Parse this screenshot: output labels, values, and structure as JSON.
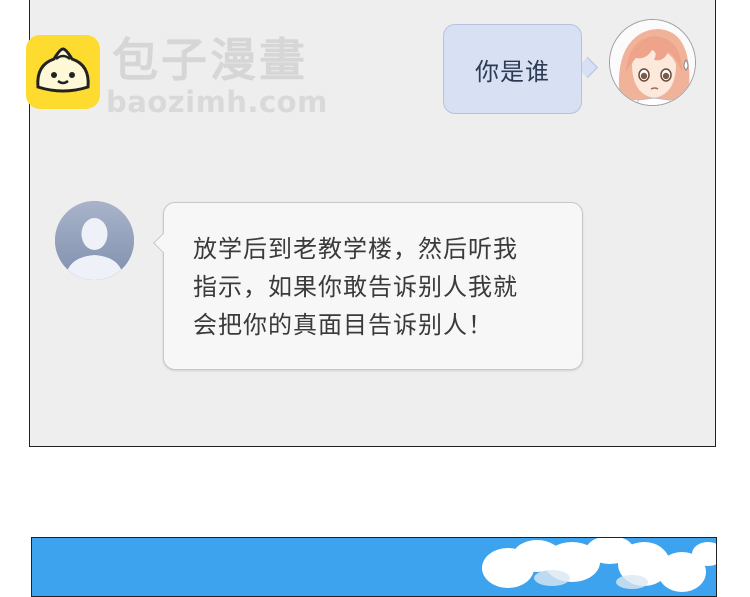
{
  "watermark": {
    "title": "包子漫畫",
    "url": "baozimh.com"
  },
  "chat": {
    "outgoing_message": "你是谁",
    "incoming_message_lines": [
      "放学后到老教学楼，然后听我",
      "指示，如果你敢告诉别人我就",
      "会把你的真面目告诉别人！"
    ]
  },
  "icons": {
    "logo": "bun-logo-icon",
    "girl_avatar": "girl-avatar-icon",
    "default_avatar": "person-silhouette-icon"
  },
  "colors": {
    "chat_background": "#eeeeef",
    "outgoing_bubble": "#d7e1f3",
    "incoming_bubble": "#f7f7f7",
    "logo_yellow": "#fddc2f",
    "sky_blue": "#3ea3ee"
  }
}
